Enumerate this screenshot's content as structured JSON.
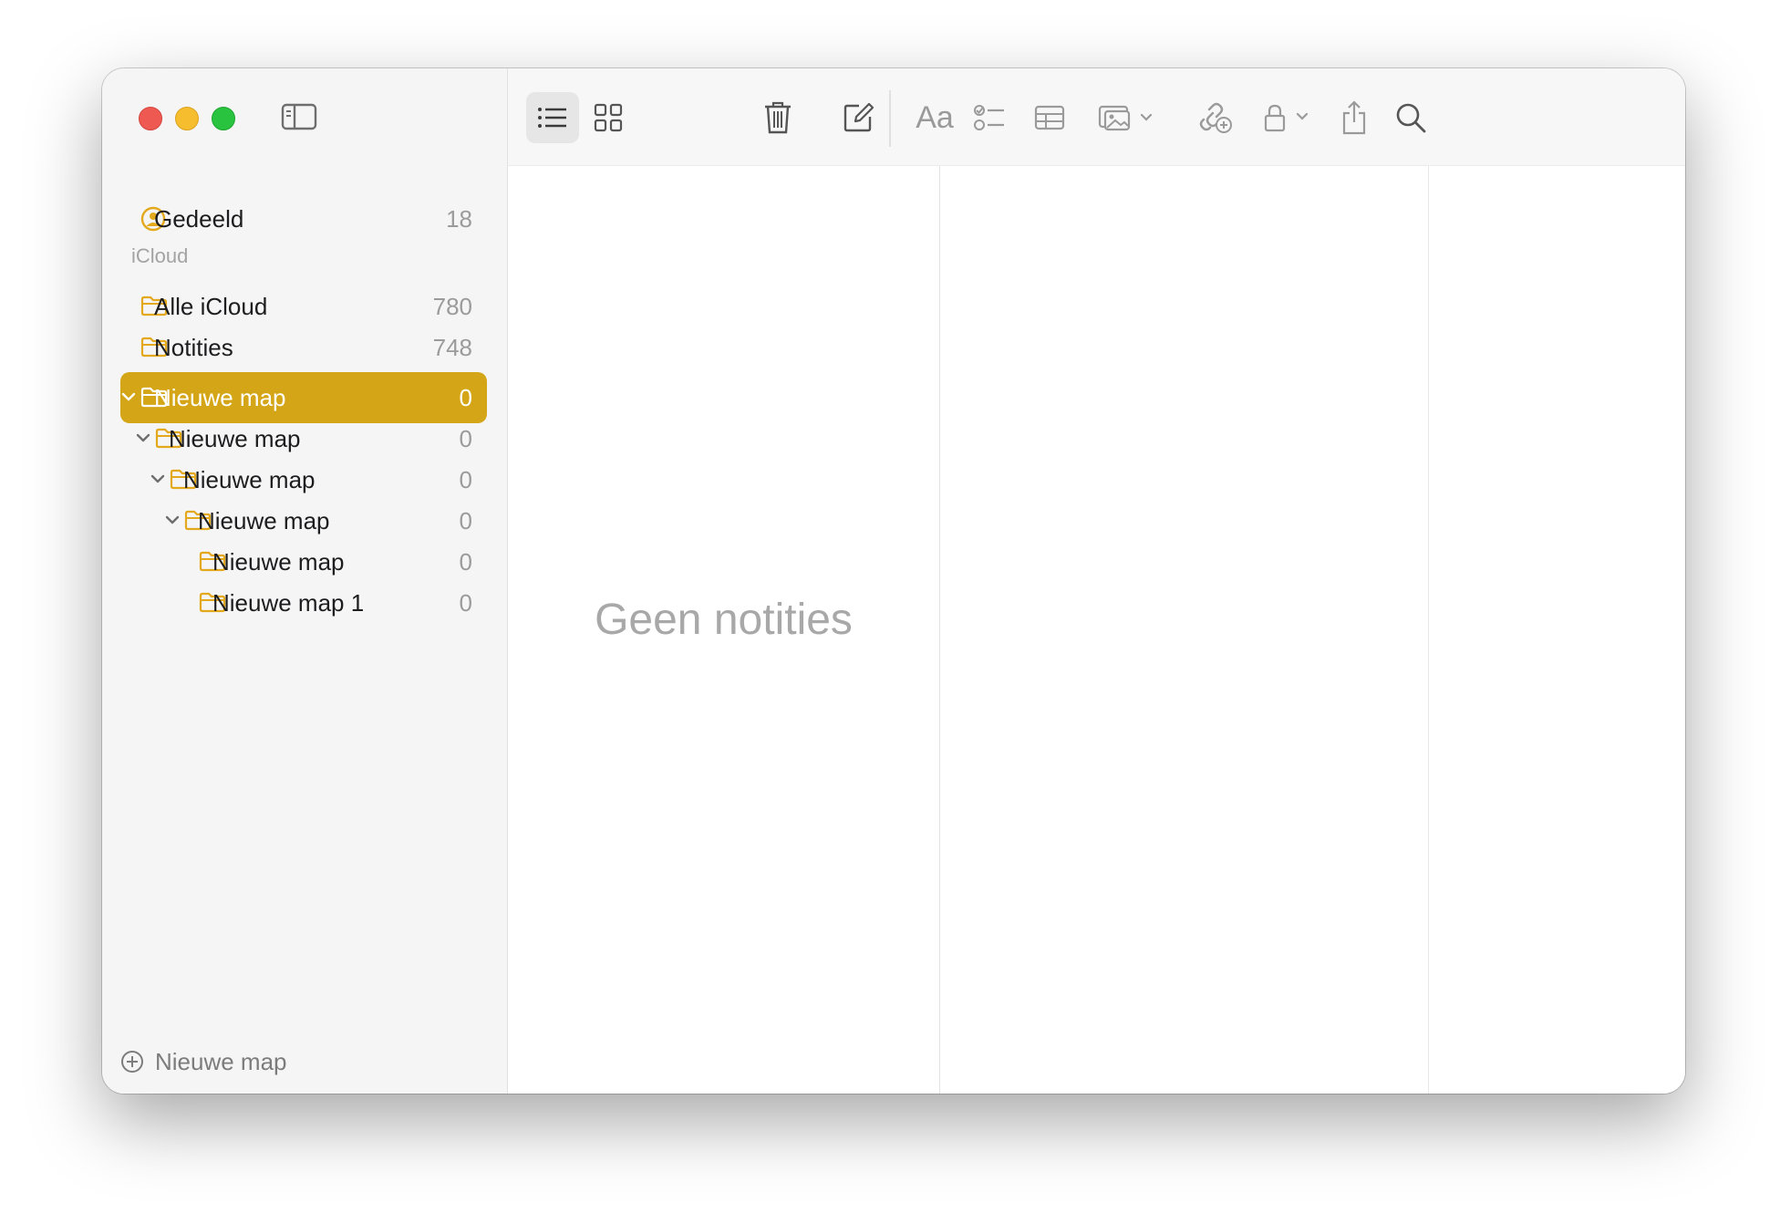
{
  "sidebar": {
    "shared": {
      "label": "Gedeeld",
      "count": "18"
    },
    "section_title": "iCloud",
    "folders": [
      {
        "label": "Alle iCloud",
        "count": "780"
      },
      {
        "label": "Notities",
        "count": "748"
      },
      {
        "label": "Nieuwe map",
        "count": "0",
        "selected": true,
        "expanded": true
      },
      {
        "label": "Nieuwe map",
        "count": "0",
        "expanded": true
      },
      {
        "label": "Nieuwe map",
        "count": "0",
        "expanded": true
      },
      {
        "label": "Nieuwe map",
        "count": "0",
        "expanded": true
      },
      {
        "label": "Nieuwe map",
        "count": "0"
      },
      {
        "label": "Nieuwe map 1",
        "count": "0"
      }
    ],
    "new_folder_label": "Nieuwe map"
  },
  "toolbar": {
    "format_label": "Aa",
    "icons": [
      "list-view-icon",
      "gallery-view-icon",
      "trash-icon",
      "compose-icon",
      "format-icon",
      "checklist-icon",
      "table-icon",
      "media-icon",
      "collaborate-icon",
      "lock-icon",
      "share-icon",
      "search-icon"
    ]
  },
  "note_list": {
    "empty_text": "Geen notities"
  },
  "colors": {
    "accent": "#d4a617",
    "folder_icon": "#e3a81c",
    "text": "#1d1d1f",
    "muted": "#9b9b9b"
  }
}
